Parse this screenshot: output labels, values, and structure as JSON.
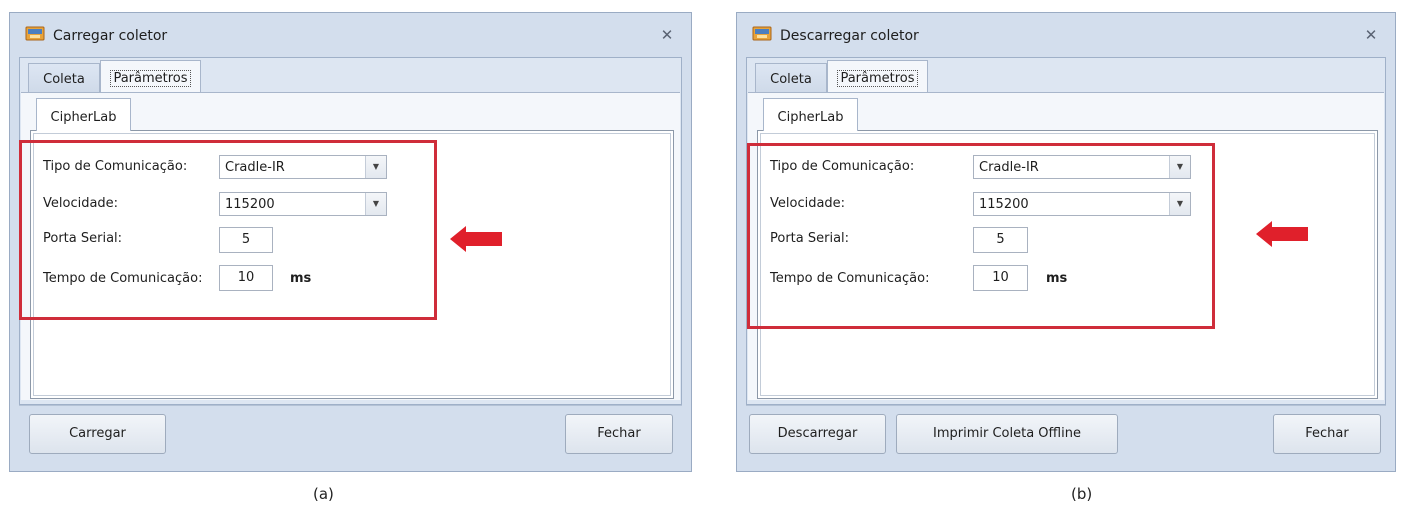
{
  "colors": {
    "highlight": "#cf2d3a",
    "dialog_bg": "#d3deed"
  },
  "left": {
    "title": "Carregar coletor",
    "tabs": [
      "Coleta",
      "Parâmetros"
    ],
    "subtab": "CipherLab",
    "fields": {
      "tipo_label": "Tipo de Comunicação:",
      "tipo_value": "Cradle-IR",
      "velocidade_label": "Velocidade:",
      "velocidade_value": "115200",
      "porta_label": "Porta Serial:",
      "porta_value": "5",
      "tempo_label": "Tempo de Comunicação:",
      "tempo_value": "10",
      "tempo_unit": "ms"
    },
    "buttons": {
      "action": "Carregar",
      "close": "Fechar"
    },
    "caption": "(a)"
  },
  "right": {
    "title": "Descarregar coletor",
    "tabs": [
      "Coleta",
      "Parâmetros"
    ],
    "subtab": "CipherLab",
    "fields": {
      "tipo_label": "Tipo de Comunicação:",
      "tipo_value": "Cradle-IR",
      "velocidade_label": "Velocidade:",
      "velocidade_value": "115200",
      "porta_label": "Porta Serial:",
      "porta_value": "5",
      "tempo_label": "Tempo de Comunicação:",
      "tempo_value": "10",
      "tempo_unit": "ms"
    },
    "buttons": {
      "action": "Descarregar",
      "print": "Imprimir Coleta Offline",
      "close": "Fechar"
    },
    "caption": "(b)"
  }
}
